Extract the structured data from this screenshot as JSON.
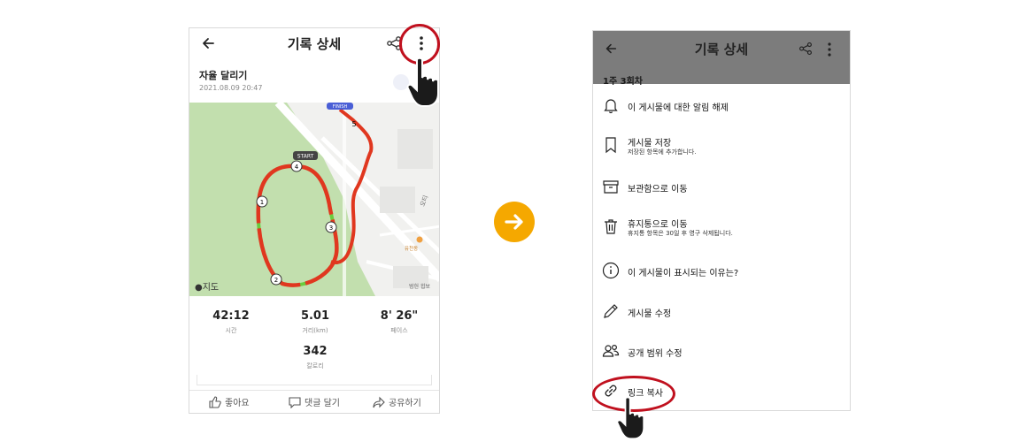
{
  "left_screen": {
    "title": "기록 상세",
    "record_name": "자율 달리기",
    "record_date": "2021.08.09 20:47",
    "map": {
      "start_label": "START",
      "finish_label": "FINISH",
      "markers": [
        "1",
        "2",
        "3",
        "4",
        "5"
      ],
      "attribution": "지도",
      "road_labels": [
        "오티",
        "유천동",
        "범헌 힙보"
      ],
      "route_color": "#e0371f",
      "park_color": "#c2dfae"
    },
    "stats": [
      {
        "value": "42:12",
        "label": "시간"
      },
      {
        "value": "5.01",
        "label": "거리(km)"
      },
      {
        "value": "8' 26\"",
        "label": "페이스"
      },
      {
        "value": "342",
        "label": "칼로리"
      }
    ],
    "actions": {
      "like": "좋아요",
      "comment": "댓글 달기",
      "share": "공유하기"
    }
  },
  "transition_arrow_color": "#f5a800",
  "highlight_color": "#c0101e",
  "right_screen": {
    "title": "기록 상세",
    "subtitle": "1주 3회차",
    "menu": [
      {
        "icon": "bell-icon",
        "title": "이 게시물에 대한 알림 해제",
        "sub": ""
      },
      {
        "icon": "bookmark-icon",
        "title": "게시물 저장",
        "sub": "저장된 항목에 추가합니다."
      },
      {
        "icon": "archive-icon",
        "title": "보관함으로 이동",
        "sub": ""
      },
      {
        "icon": "trash-icon",
        "title": "휴지통으로 이동",
        "sub": "휴지통 항목은 30일 후 영구 삭제됩니다."
      },
      {
        "icon": "info-icon",
        "title": "이 게시물이 표시되는 이유는?",
        "sub": ""
      },
      {
        "icon": "pencil-icon",
        "title": "게시물 수정",
        "sub": ""
      },
      {
        "icon": "people-icon",
        "title": "공개 범위 수정",
        "sub": ""
      },
      {
        "icon": "link-icon",
        "title": "링크 복사",
        "sub": ""
      }
    ]
  }
}
